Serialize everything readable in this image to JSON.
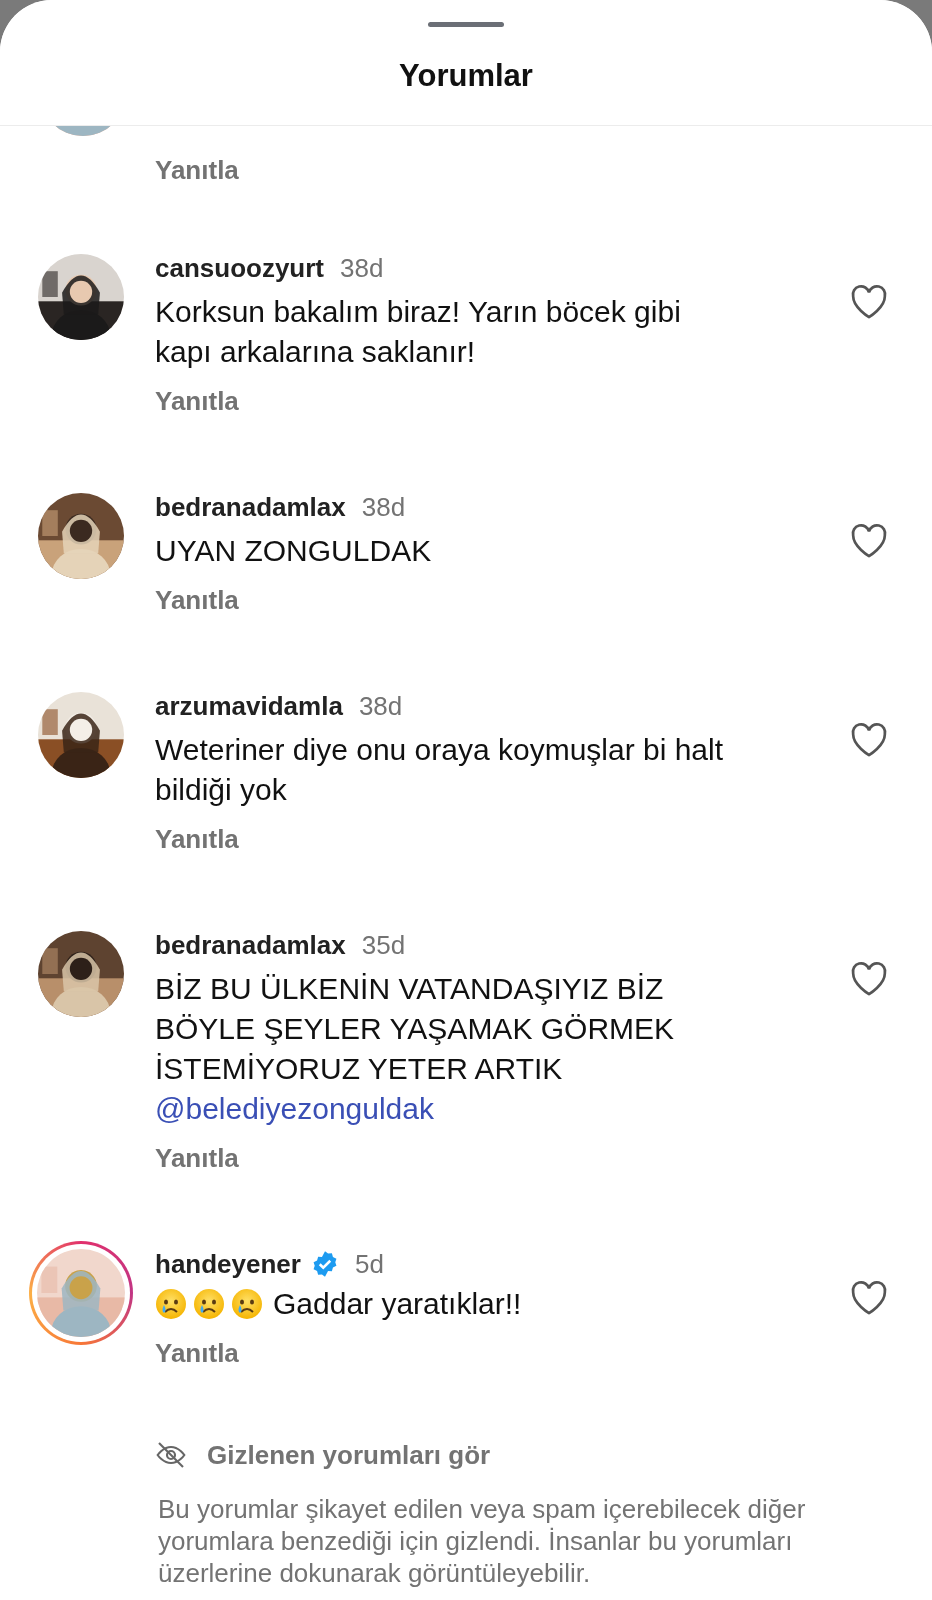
{
  "header": {
    "title": "Yorumlar"
  },
  "partial_comment": {
    "reply": "Yanıtla"
  },
  "comments": [
    {
      "username": "cansuoozyurt",
      "time": "38d",
      "verified": false,
      "story_ring": false,
      "leading_emoji": false,
      "text": "Korksun bakalım biraz! Yarın böcek gibi kapı arkalarına saklanır!",
      "reply": "Yanıtla"
    },
    {
      "username": "bedranadamlax",
      "time": "38d",
      "verified": false,
      "story_ring": false,
      "leading_emoji": false,
      "text": "UYAN ZONGULDAK",
      "reply": "Yanıtla"
    },
    {
      "username": "arzumavidamla",
      "time": "38d",
      "verified": false,
      "story_ring": false,
      "leading_emoji": false,
      "text": "Weteriner diye onu oraya koymuşlar bi halt bildiği yok",
      "reply": "Yanıtla"
    },
    {
      "username": "bedranadamlax",
      "time": "35d",
      "verified": false,
      "story_ring": false,
      "leading_emoji": false,
      "text": "BİZ BU ÜLKENİN VATANDAŞIYIZ BİZ BÖYLE ŞEYLER YAŞAMAK GÖRMEK İSTEMİYORUZ YETER ARTIK",
      "mention": "@belediyezonguldak",
      "reply": "Yanıtla"
    },
    {
      "username": "handeyener",
      "time": "5d",
      "verified": true,
      "story_ring": true,
      "leading_emoji": true,
      "text": "Gaddar yaratıklar!!",
      "reply": "Yanıtla"
    }
  ],
  "hidden": {
    "link": "Gizlenen yorumları gör",
    "note": "Bu yorumlar şikayet edilen veya spam içerebilecek diğer yorumlara benzediği için gizlendi. İnsanlar bu yorumları üzerlerine dokunarak görüntüleyebilir."
  }
}
